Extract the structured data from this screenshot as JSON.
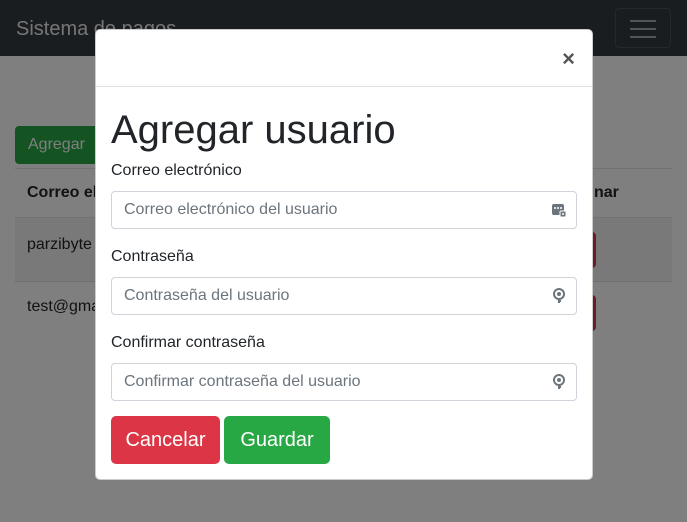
{
  "navbar": {
    "brand": "Sistema de pagos"
  },
  "page": {
    "add_button": "Agregar",
    "table": {
      "headers": [
        "Correo el",
        "nar"
      ],
      "rows": [
        {
          "email": "parzibyte"
        },
        {
          "email": "test@gma"
        }
      ]
    }
  },
  "modal": {
    "close": "×",
    "title": "Agregar usuario",
    "email_label": "Correo electrónico",
    "email_placeholder": "Correo electrónico del usuario",
    "password_label": "Contraseña",
    "password_placeholder": "Contraseña del usuario",
    "confirm_label": "Confirmar contraseña",
    "confirm_placeholder": "Confirmar contraseña del usuario",
    "cancel": "Cancelar",
    "save": "Guardar"
  },
  "colors": {
    "navbar": "#343a40",
    "success": "#28a745",
    "danger": "#dc3545"
  }
}
